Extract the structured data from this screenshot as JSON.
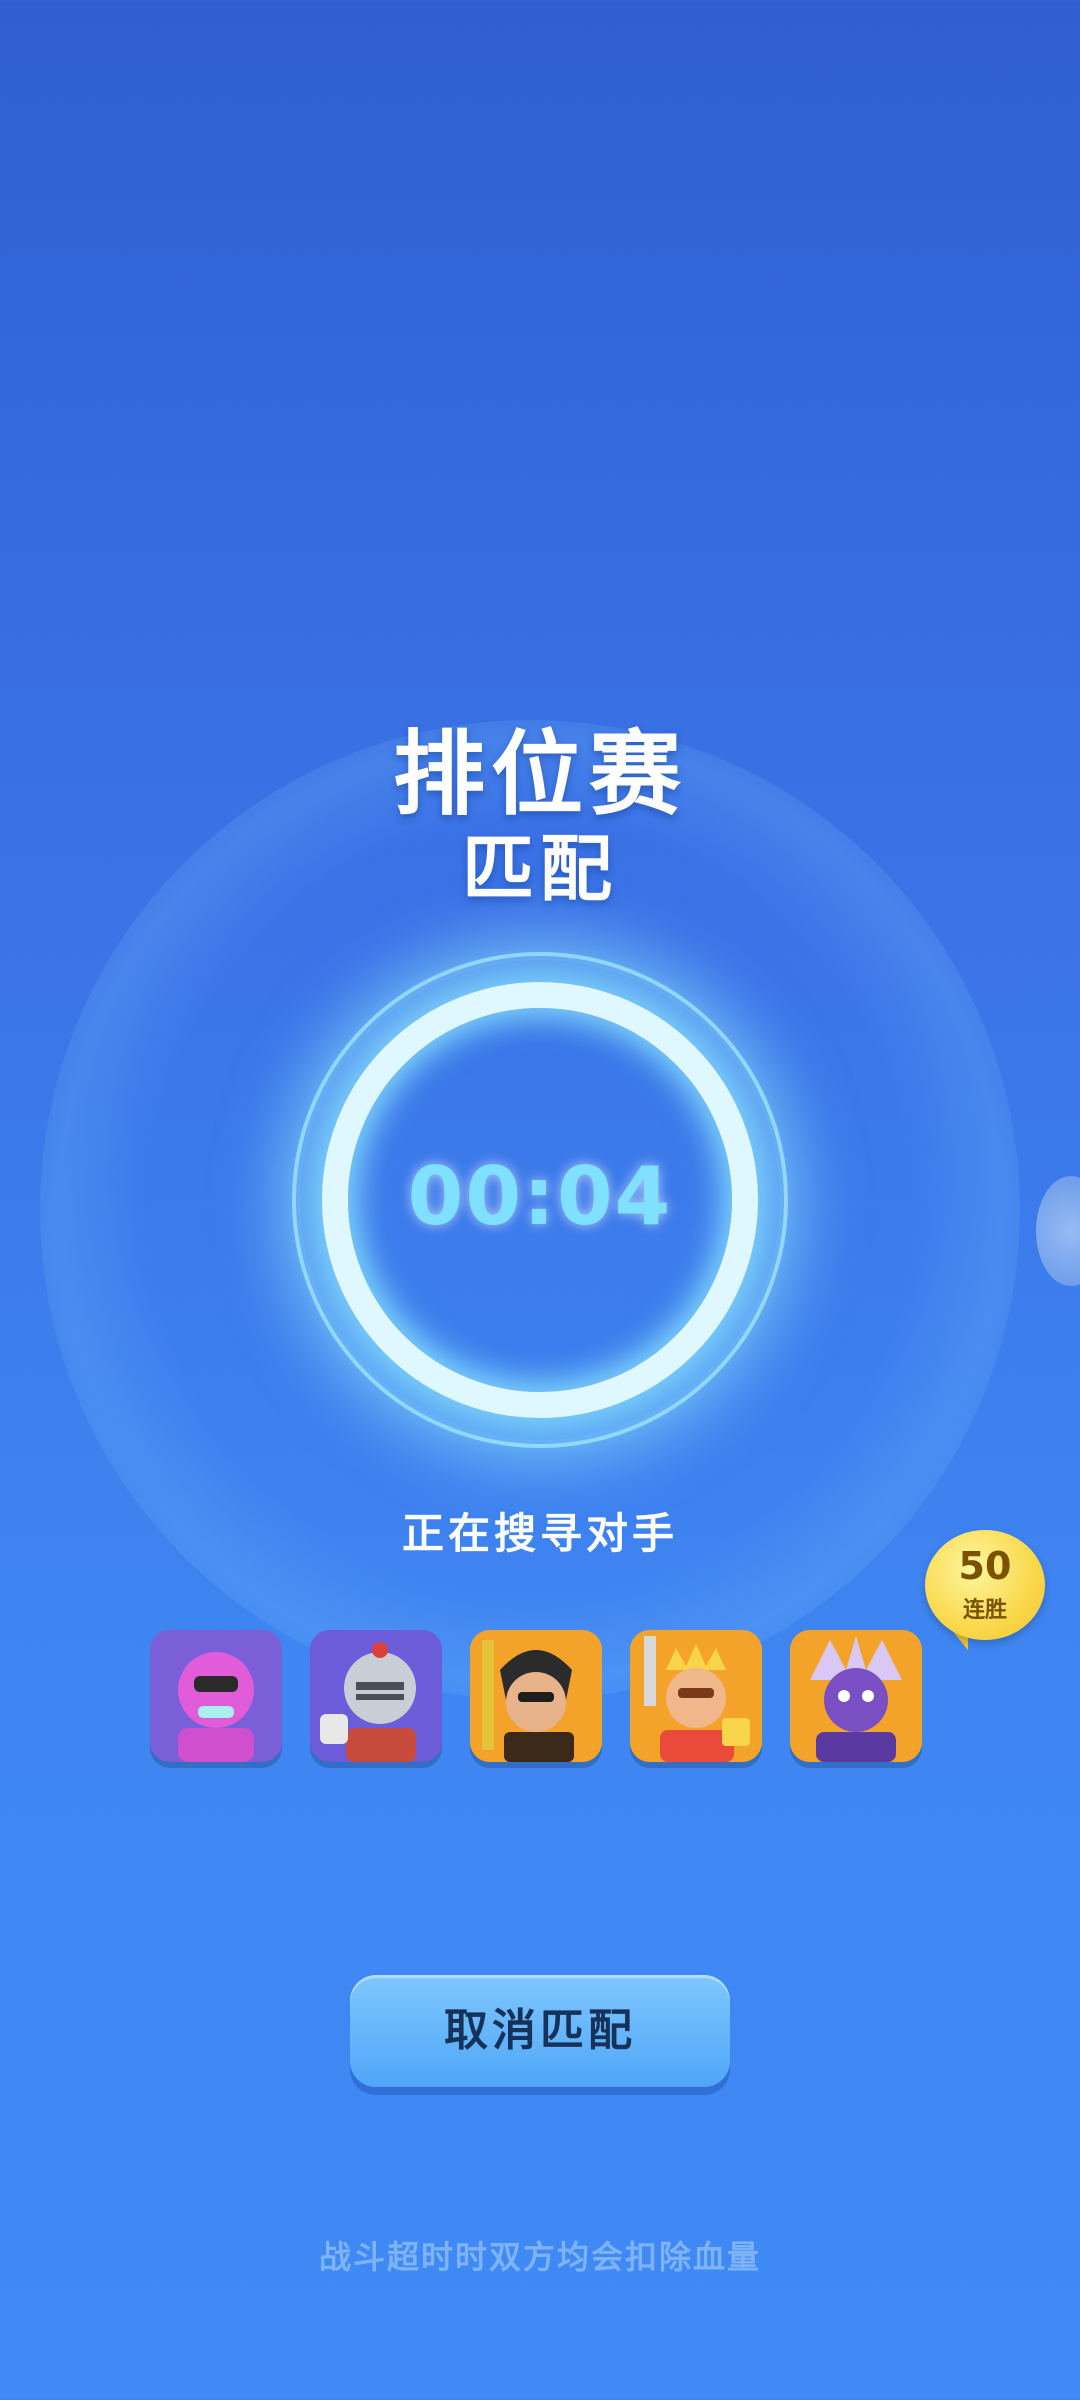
{
  "header": {
    "title": "排位赛",
    "subtitle": "匹配"
  },
  "matching": {
    "timer": "00:04",
    "status": "正在搜寻对手"
  },
  "streak": {
    "count": "50",
    "label": "连胜"
  },
  "avatars": [
    {
      "icon": "pink-brawler-avatar-icon",
      "bg": "#7a5fd8"
    },
    {
      "icon": "knight-helmet-avatar-icon",
      "bg": "#6d5cd9"
    },
    {
      "icon": "monkey-king-avatar-icon",
      "bg": "#f3a32a"
    },
    {
      "icon": "golden-king-avatar-icon",
      "bg": "#f3a32a"
    },
    {
      "icon": "purple-demon-avatar-icon",
      "bg": "#f3a32a"
    }
  ],
  "actions": {
    "cancel_label": "取消匹配"
  },
  "footer": {
    "note": "战斗超时时双方均会扣除血量"
  }
}
